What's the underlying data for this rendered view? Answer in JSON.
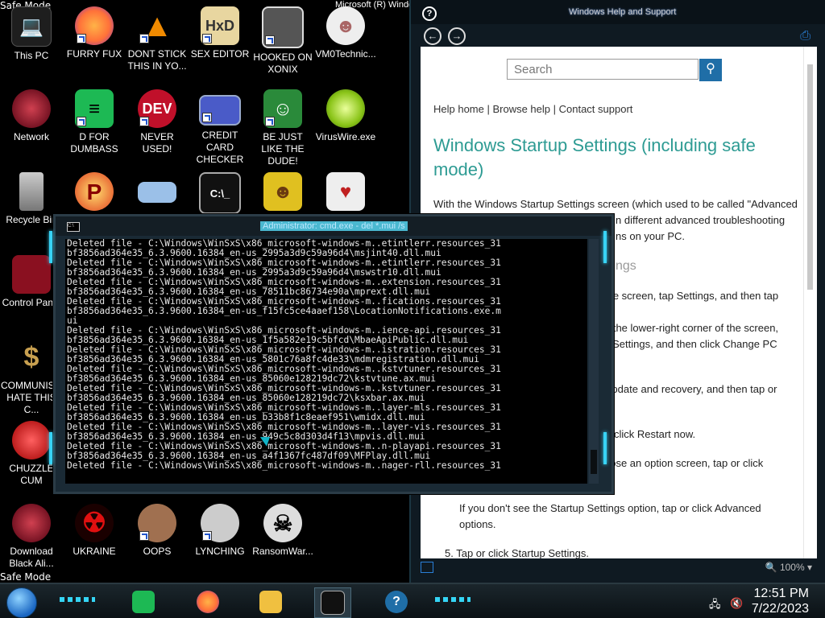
{
  "desktop": {
    "safe_mode_label": "Safe Mode",
    "os_version": "Microsoft (R) Windows",
    "icons": [
      {
        "label": "This PC",
        "icon": "computer-icon",
        "color": "#2a2a2a"
      },
      {
        "label": "FURRY FUX",
        "icon": "firefox-icon",
        "color": "#ff7139"
      },
      {
        "label": "DONT STICK THIS IN YO...",
        "icon": "vlc-cone-icon",
        "color": "#f08a00"
      },
      {
        "label": "SEX EDITOR",
        "icon": "hxd-editor-icon",
        "color": "#d8a030"
      },
      {
        "label": "HOOKED ON XONIX",
        "icon": "xonix-game-icon",
        "color": "#555555"
      },
      {
        "label": "VM0Technic...",
        "icon": "doctor-icon",
        "color": "#c0c0c0"
      },
      {
        "label": "Network",
        "icon": "network-globe-icon",
        "color": "#8a1020"
      },
      {
        "label": "D FOR DUMBASS",
        "icon": "spotify-icon",
        "color": "#1db954"
      },
      {
        "label": "NEVER USED!",
        "icon": "dev-badge-icon",
        "color": "#c0102a"
      },
      {
        "label": "CREDIT CARD CHECKER",
        "icon": "credit-card-icon",
        "color": "#4a5bc8"
      },
      {
        "label": "BE JUST LIKE THE DUDE!",
        "icon": "elf-icon",
        "color": "#2a8a3a"
      },
      {
        "label": "VirusWire.exe",
        "icon": "lime-icon",
        "color": "#9ad420"
      },
      {
        "label": "Recycle Bin",
        "icon": "recycle-bin-icon",
        "color": "#b0b0b0"
      },
      {
        "label": "",
        "icon": "p-app-icon",
        "color": "#e04020"
      },
      {
        "label": "",
        "icon": "projector-icon",
        "color": "#4a8ad8"
      },
      {
        "label": "",
        "icon": "terminal-icon",
        "color": "#303030"
      },
      {
        "label": "",
        "icon": "dog-icon",
        "color": "#e0c020"
      },
      {
        "label": "",
        "icon": "cards-icon",
        "color": "#c02020"
      },
      {
        "label": "Control Panel",
        "icon": "control-panel-icon",
        "color": "#8a1020"
      },
      {
        "label": "COMMUNISM HATE THIS C...",
        "icon": "money-bag-icon",
        "color": "#c8a050"
      },
      {
        "label": "CHUZZLE CUM",
        "icon": "chuzzle-icon",
        "color": "#d02020"
      },
      {
        "label": "Download Black Ali...",
        "icon": "alien-globe-icon",
        "color": "#8a1020"
      },
      {
        "label": "UKRAINE",
        "icon": "radiation-icon",
        "color": "#c01010"
      },
      {
        "label": "OOPS",
        "icon": "portrait-icon",
        "color": "#a07050"
      },
      {
        "label": "LYNCHING",
        "icon": "helmet-icon",
        "color": "#cccccc"
      },
      {
        "label": "RansomWar...",
        "icon": "skull-icon",
        "color": "#dddddd"
      }
    ]
  },
  "help_window": {
    "title": "Windows Help and Support",
    "search_placeholder": "Search",
    "nav_links": "Help home | Browse help | Contact support",
    "heading": "Windows Startup Settings (including safe mode)",
    "paragraphs": [
      "With the Windows Startup Settings screen (which used to be called \"Advanced",
      "n different advanced troubleshooting",
      "ns on your PC."
    ],
    "subheading": "ngs",
    "steps": [
      "the screen, tap Settings, and then tap",
      "p the lower-right corner of the screen,",
      "k Settings, and then click Change PC",
      "Update and recovery, and then tap or",
      "click Restart now.",
      "pose an option screen, tap or click",
      "If you don't see the Startup Settings option, tap or click Advanced",
      "options.",
      "5. Tap or click Startup Settings."
    ],
    "zoom_level": "100%"
  },
  "cmd_window": {
    "title": "Administrator: cmd.exe - del  *.mui /s",
    "lines": [
      "Deleted file - C:\\Windows\\WinSxS\\x86_microsoft-windows-m..etintlerr.resources_31",
      "bf3856ad364e35_6.3.9600.16384_en-us_2995a3d9c59a96d4\\msjint40.dll.mui",
      "Deleted file - C:\\Windows\\WinSxS\\x86_microsoft-windows-m..etintlerr.resources_31",
      "bf3856ad364e35_6.3.9600.16384_en-us_2995a3d9c59a96d4\\mswstr10.dll.mui",
      "Deleted file - C:\\Windows\\WinSxS\\x86_microsoft-windows-m..extension.resources_31",
      "bf3856ad364e35_6.3.9600.16384_en-us_78511bc86734e90a\\mprext.dll.mui",
      "Deleted file - C:\\Windows\\WinSxS\\x86_microsoft-windows-m..fications.resources_31",
      "bf3856ad364e35_6.3.9600.16384_en-us_f15fc5ce4aaef158\\LocationNotifications.exe.m",
      "ui",
      "Deleted file - C:\\Windows\\WinSxS\\x86_microsoft-windows-m..ience-api.resources_31",
      "bf3856ad364e35_6.3.9600.16384_en-us_1f5a582e19c5bfcd\\MbaeApiPublic.dll.mui",
      "Deleted file - C:\\Windows\\WinSxS\\x86_microsoft-windows-m..istration.resources_31",
      "bf3856ad364e35_6.3.9600.16384_en-us_5801c76a8fc4de33\\mdmregistration.dll.mui",
      "Deleted file - C:\\Windows\\WinSxS\\x86_microsoft-windows-m..kstvtuner.resources_31",
      "bf3856ad364e35_6.3.9600.16384_en-us_85060e128219dc72\\kstvtune.ax.mui",
      "Deleted file - C:\\Windows\\WinSxS\\x86_microsoft-windows-m..kstvtuner.resources_31",
      "bf3856ad364e35_6.3.9600.16384_en-us_85060e128219dc72\\ksxbar.ax.mui",
      "Deleted file - C:\\Windows\\WinSxS\\x86_microsoft-windows-m..layer-mls.resources_31",
      "bf3856ad364e35_6.3.9600.16384_en-us_b33b8f1c8eaef951\\wmidx.dll.mui",
      "Deleted file - C:\\Windows\\WinSxS\\x86_microsoft-windows-m..layer-vis.resources_31",
      "bf3856ad364e35_6.3.9600.16384_en-us_949c5c8d303d4f13\\mpvis.dll.mui",
      "Deleted file - C:\\Windows\\WinSxS\\x86_microsoft-windows-m..n-playapi.resources_31",
      "bf3856ad364e35_6.3.9600.16384_en-us_a4f1367fc487df09\\MFPlay.dll.mui",
      "Deleted file - C:\\Windows\\WinSxS\\x86_microsoft-windows-m..nager-rll.resources_31"
    ]
  },
  "taskbar": {
    "time": "12:51 PM",
    "date": "7/22/2023",
    "apps": [
      {
        "icon": "spotify-icon",
        "color": "#1db954"
      },
      {
        "icon": "firefox-icon",
        "color": "#ff7139"
      },
      {
        "icon": "file-explorer-icon",
        "color": "#f0c040"
      },
      {
        "icon": "cmd-icon",
        "color": "#222222"
      },
      {
        "icon": "help-icon",
        "color": "#1f6ea7"
      }
    ]
  }
}
